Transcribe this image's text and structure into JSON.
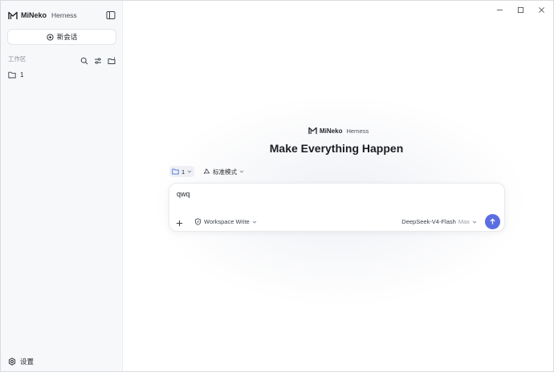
{
  "app": {
    "brand_name": "MiNeko",
    "brand_sub": "Herness"
  },
  "sidebar": {
    "new_chat_label": "新会话",
    "workspace_title": "工作区",
    "folders": [
      {
        "label": "1"
      }
    ],
    "settings_label": "设置"
  },
  "main": {
    "hero_brand_name": "MiNeko",
    "hero_brand_sub": "Herness",
    "hero_title": "Make Everything Happen",
    "workspace_chip": "1",
    "mode_chip": "标准模式",
    "composer": {
      "text": "qwq",
      "permission_label": "Workspace Write",
      "model_label": "DeepSeek-V4-Flash",
      "effort_label": "Max"
    }
  },
  "colors": {
    "accent": "#5b6ee1",
    "sidebar_bg": "#f7f8fa",
    "folder_icon": "#4a6fd8"
  }
}
